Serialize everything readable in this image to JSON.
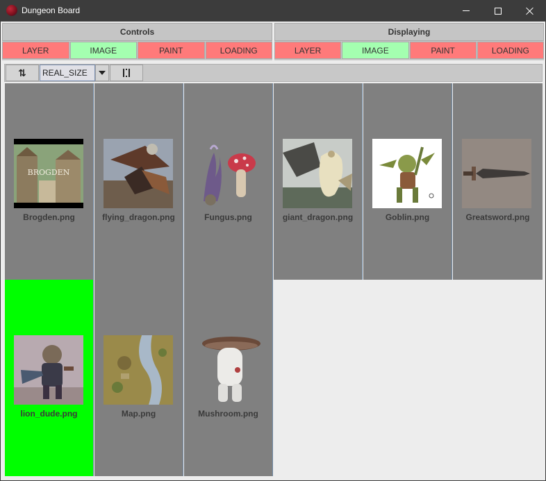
{
  "window": {
    "title": "Dungeon Board"
  },
  "panels": {
    "controls": {
      "title": "Controls",
      "tabs": [
        {
          "label": "LAYER",
          "active": false
        },
        {
          "label": "IMAGE",
          "active": true
        },
        {
          "label": "PAINT",
          "active": false
        },
        {
          "label": "LOADING",
          "active": false
        }
      ]
    },
    "displaying": {
      "title": "Displaying",
      "tabs": [
        {
          "label": "LAYER",
          "active": false
        },
        {
          "label": "IMAGE",
          "active": true
        },
        {
          "label": "PAINT",
          "active": false
        },
        {
          "label": "LOADING",
          "active": false
        }
      ]
    }
  },
  "toolbar": {
    "scale_mode": "REAL_SIZE",
    "icons": [
      "swap-icon",
      "chevron-down-icon",
      "fit-to-screen-icon"
    ]
  },
  "images": [
    {
      "name": "Brogden.png",
      "selected": false,
      "icon": "town-thumbnail"
    },
    {
      "name": "flying_dragon.png",
      "selected": false,
      "icon": "dragon-thumbnail"
    },
    {
      "name": "Fungus.png",
      "selected": false,
      "icon": "fungus-thumbnail"
    },
    {
      "name": "giant_dragon.png",
      "selected": false,
      "icon": "dragon-thumbnail"
    },
    {
      "name": "Goblin.png",
      "selected": false,
      "icon": "goblin-thumbnail"
    },
    {
      "name": "Greatsword.png",
      "selected": false,
      "icon": "sword-thumbnail"
    },
    {
      "name": "lion_dude.png",
      "selected": true,
      "icon": "lion-warrior-thumbnail"
    },
    {
      "name": "Map.png",
      "selected": false,
      "icon": "map-thumbnail"
    },
    {
      "name": "Mushroom.png",
      "selected": false,
      "icon": "mushroom-thumbnail"
    }
  ],
  "colors": {
    "tab_inactive": "#ff7a7a",
    "tab_active": "#a4ffb0",
    "selected_cell": "#00ff00",
    "cell_bg": "#808080"
  }
}
